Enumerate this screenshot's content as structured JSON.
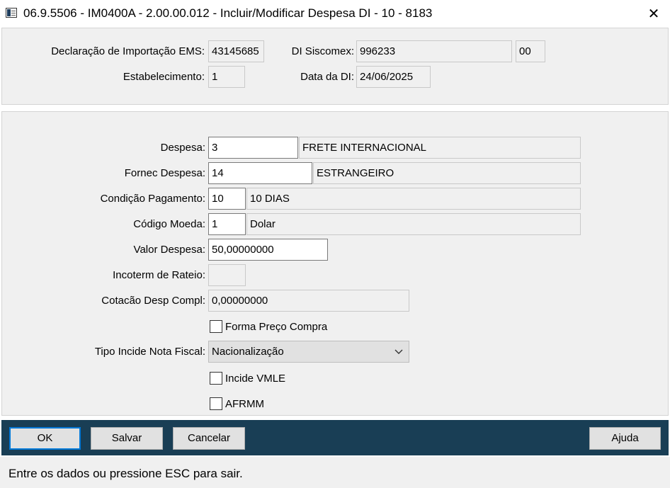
{
  "window": {
    "title": "06.9.5506 - IM0400A - 2.00.00.012 - Incluir/Modificar Despesa DI - 10 - 8183",
    "close_glyph": "✕"
  },
  "header": {
    "declaracao_label": "Declaração de Importação EMS:",
    "declaracao_value": "43145685",
    "di_siscomex_label": "DI Siscomex:",
    "di_siscomex_value": "996233",
    "di_siscomex_suffix": "00",
    "estabelecimento_label": "Estabelecimento:",
    "estabelecimento_value": "1",
    "data_di_label": "Data da DI:",
    "data_di_value": "24/06/2025"
  },
  "form": {
    "despesa_label": "Despesa:",
    "despesa_code": "3",
    "despesa_desc": "FRETE INTERNACIONAL",
    "fornec_label": "Fornec Despesa:",
    "fornec_code": "14",
    "fornec_desc": "ESTRANGEIRO",
    "condicao_label": "Condição Pagamento:",
    "condicao_code": "10",
    "condicao_desc": "10 DIAS",
    "moeda_label": "Código Moeda:",
    "moeda_code": "1",
    "moeda_desc": "Dolar",
    "valor_label": "Valor Despesa:",
    "valor_value": "50,00000000",
    "incoterm_label": "Incoterm de Rateio:",
    "incoterm_value": "",
    "cotacao_label": "Cotacão Desp Compl:",
    "cotacao_value": "0,00000000",
    "forma_preco_label": "Forma Preço Compra",
    "tipo_incide_label": "Tipo Incide Nota Fiscal:",
    "tipo_incide_value": "Nacionalização",
    "incide_vmle_label": "Incide VMLE",
    "afrmm_label": "AFRMM"
  },
  "buttons": {
    "ok": "OK",
    "salvar": "Salvar",
    "cancelar": "Cancelar",
    "ajuda": "Ajuda"
  },
  "status": {
    "message": "Entre os dados ou pressione ESC para sair."
  }
}
